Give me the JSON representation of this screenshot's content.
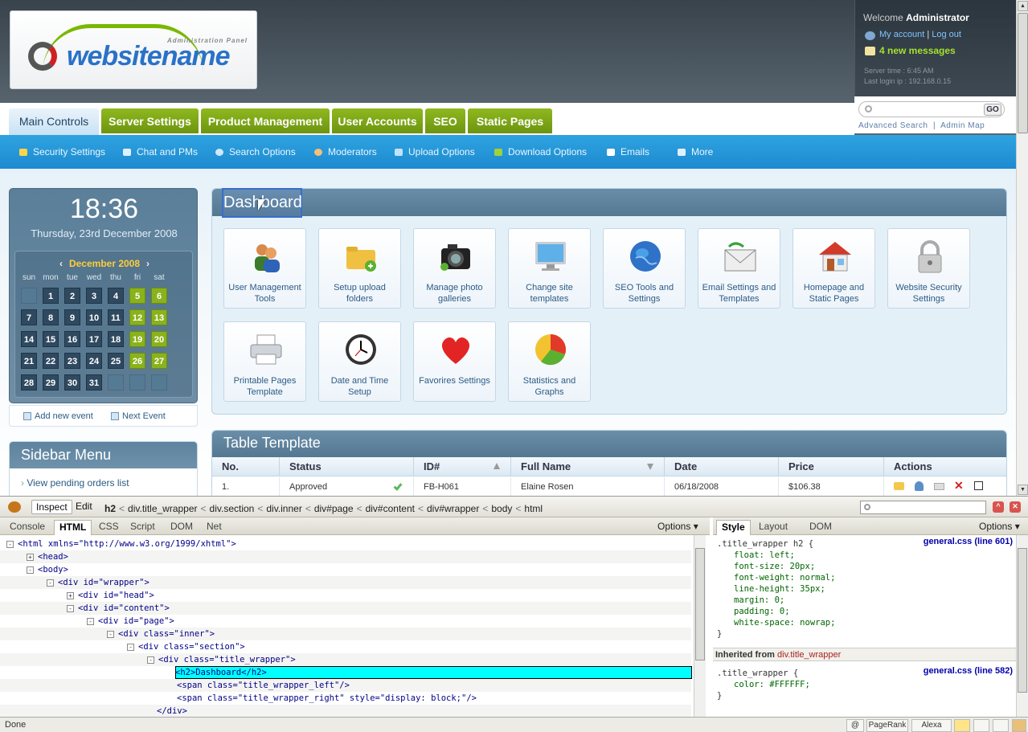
{
  "header": {
    "logo_tagline": "Administration Panel",
    "logo_name": "websitename",
    "welcome_prefix": "Welcome",
    "user": "Administrator",
    "my_account": "My account",
    "logout": "Log out",
    "link_sep": "|",
    "messages": "4 new messages",
    "server_time": "Server time : 6:45 AM",
    "last_login": "Last login ip : 192.168.0.15",
    "search_go": "GO",
    "advanced_search": "Advanced Search",
    "search_links_sep": "|",
    "admin_map": "Admin Map"
  },
  "tabs": [
    "Main Controls",
    "Server Settings",
    "Product Management",
    "User Accounts",
    "SEO",
    "Static Pages"
  ],
  "subnav": [
    "Security Settings",
    "Chat and PMs",
    "Search Options",
    "Moderators",
    "Upload Options",
    "Download Options",
    "Emails",
    "More"
  ],
  "clock": {
    "time": "18:36",
    "date": "Thursday, 23rd December 2008"
  },
  "calendar": {
    "month": "December 2008",
    "prev": "‹",
    "next": "›",
    "weekdays": [
      "sun",
      "mon",
      "tue",
      "wed",
      "thu",
      "fri",
      "sat"
    ],
    "weeks": [
      [
        "",
        "1",
        "2",
        "3",
        "4",
        "5",
        "6"
      ],
      [
        "7",
        "8",
        "9",
        "10",
        "11",
        "12",
        "13"
      ],
      [
        "14",
        "15",
        "16",
        "17",
        "18",
        "19",
        "20"
      ],
      [
        "21",
        "22",
        "23",
        "24",
        "25",
        "26",
        "27"
      ],
      [
        "28",
        "29",
        "30",
        "31",
        "",
        "",
        ""
      ]
    ],
    "add_event": "Add new event",
    "next_event": "Next Event"
  },
  "sidebar": {
    "title": "Sidebar Menu",
    "item": "View pending orders list",
    "bullet": "›"
  },
  "dashboard": {
    "title": "Dashboard",
    "cards": [
      {
        "label": "User Management Tools",
        "icon": "users-icon"
      },
      {
        "label": "Setup upload folders",
        "icon": "folder-add-icon"
      },
      {
        "label": "Manage photo galleries",
        "icon": "camera-icon"
      },
      {
        "label": "Change site templates",
        "icon": "monitor-icon"
      },
      {
        "label": "SEO Tools and Settings",
        "icon": "globe-icon"
      },
      {
        "label": "Email Settings and Templates",
        "icon": "email-icon"
      },
      {
        "label": "Homepage and Static Pages",
        "icon": "house-icon"
      },
      {
        "label": "Website Security Settings",
        "icon": "padlock-icon"
      },
      {
        "label": "Printable Pages Template",
        "icon": "printer-icon"
      },
      {
        "label": "Date and Time Setup",
        "icon": "clock-icon"
      },
      {
        "label": "Favorires Settings",
        "icon": "heart-icon"
      },
      {
        "label": "Statistics and Graphs",
        "icon": "pie-chart-icon"
      }
    ]
  },
  "table": {
    "title": "Table Template",
    "headers": [
      "No.",
      "Status",
      "ID#",
      "Full Name",
      "Date",
      "Price",
      "Actions"
    ],
    "row": [
      "1.",
      "Approved",
      "FB-H061",
      "Elaine Rosen",
      "06/18/2008",
      "$106.38"
    ]
  },
  "firebug": {
    "inspect": "Inspect",
    "edit": "Edit",
    "crumbs": [
      "h2",
      "div.title_wrapper",
      "div.section",
      "div.inner",
      "div#page",
      "div#content",
      "div#wrapper",
      "body",
      "html"
    ],
    "crumb_sep": "<",
    "tabs": [
      "Console",
      "HTML",
      "CSS",
      "Script",
      "DOM",
      "Net"
    ],
    "options": "Options ▾",
    "side_tabs": [
      "Style",
      "Layout",
      "DOM"
    ],
    "html_lines": [
      "<html xmlns=\"http://www.w3.org/1999/xhtml\">",
      "<head>",
      "<body>",
      "<div id=\"wrapper\">",
      "<div id=\"head\">",
      "<div id=\"content\">",
      "<div id=\"page\">",
      "<div class=\"inner\">",
      "<div class=\"section\">",
      "<div class=\"title_wrapper\">",
      "<h2>Dashboard</h2>",
      "<span class=\"title_wrapper_left\"/>",
      "<span class=\"title_wrapper_right\" style=\"display: block;\"/>",
      "</div>"
    ],
    "toggles": [
      "-",
      "+",
      "-",
      "-",
      "+",
      "-",
      "-",
      "-",
      "-",
      "-"
    ],
    "style_rule1": {
      "selector": ".title_wrapper h2 {",
      "source": "general.css (line 601)",
      "props": [
        "float: left;",
        "font-size: 20px;",
        "font-weight: normal;",
        "line-height: 35px;",
        "margin: 0;",
        "padding: 0;",
        "white-space: nowrap;"
      ],
      "close": "}"
    },
    "inherited_label": "Inherited from",
    "inherited_from": "div.title_wrapper",
    "style_rule2": {
      "selector": ".title_wrapper {",
      "source": "general.css (line 582)",
      "props": [
        "color: #FFFFFF;"
      ],
      "close": "}"
    },
    "status": "Done",
    "status_cells": [
      "@",
      "PageRank",
      "Alexa"
    ]
  }
}
